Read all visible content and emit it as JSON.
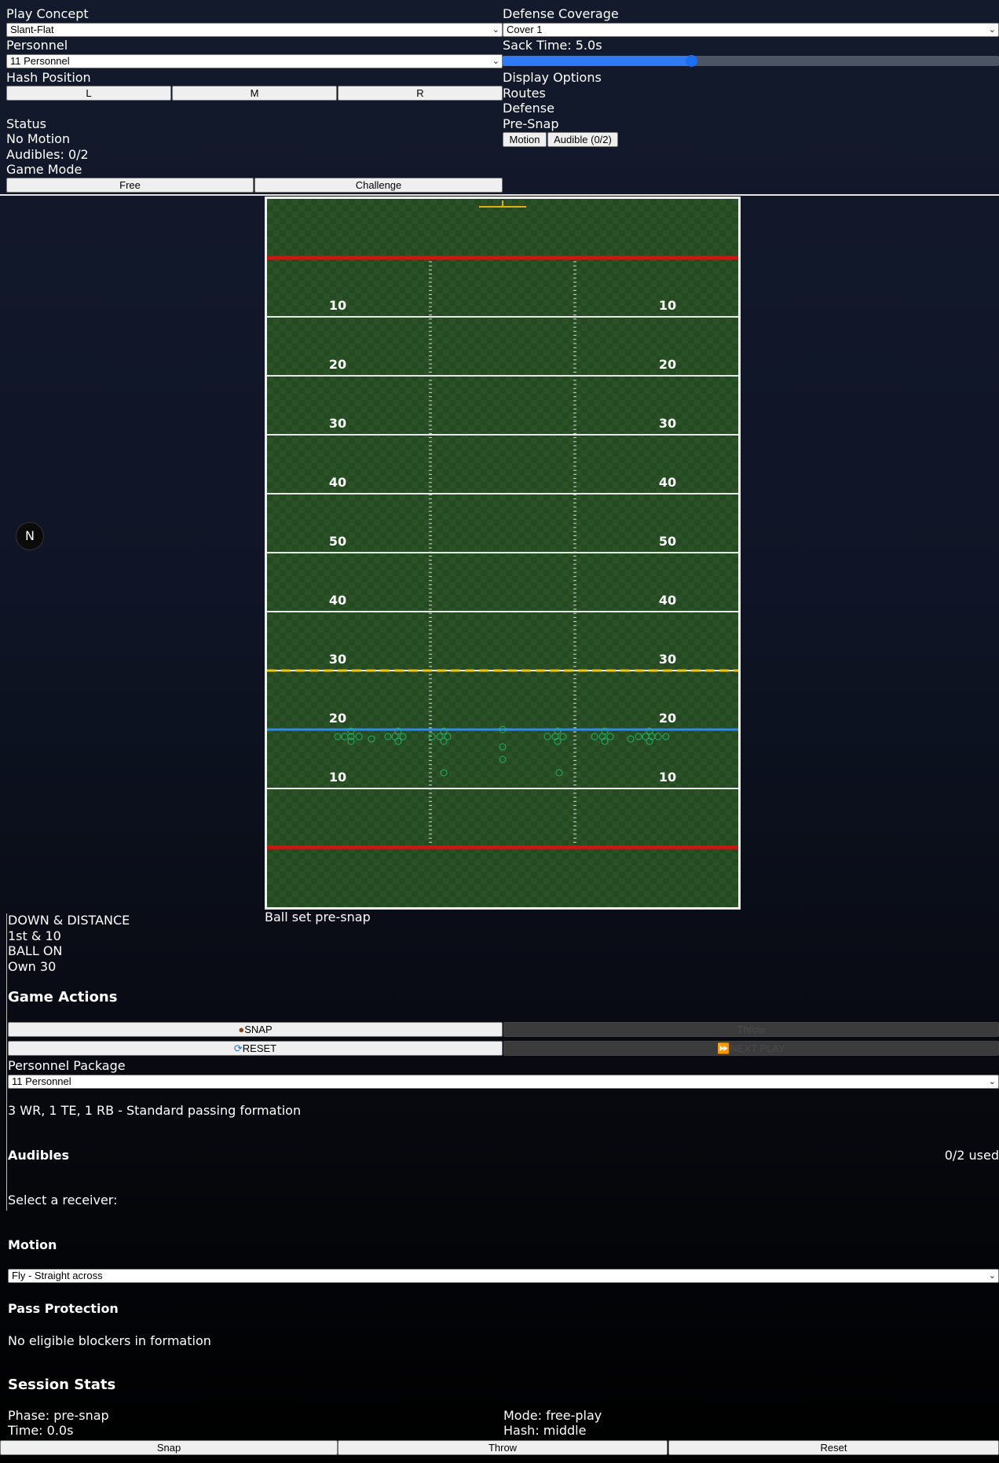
{
  "controls": {
    "play_concept_label": "Play Concept",
    "play_concept_value": "Slant-Flat",
    "defense_coverage_label": "Defense Coverage",
    "defense_coverage_value": "Cover 1",
    "personnel_label": "Personnel",
    "personnel_value": "11 Personnel",
    "sack_time_label": "Sack Time: 5.0s",
    "sack_time_fraction": 0.38,
    "hash_label": "Hash Position",
    "hash_buttons": [
      "L",
      "M",
      "R"
    ],
    "display_options_label": "Display Options",
    "display_options": [
      "Routes",
      "Defense",
      "Pre-Snap"
    ],
    "presnap_buttons": [
      "Motion",
      "Audible (0/2)"
    ],
    "status_label": "Status",
    "status_lines": [
      "No Motion",
      "Audibles: 0/2"
    ],
    "game_mode_label": "Game Mode",
    "game_mode_buttons": [
      "Free",
      "Challenge"
    ]
  },
  "field": {
    "yard_numbers": [
      "10",
      "20",
      "30",
      "40",
      "50",
      "40",
      "30",
      "20",
      "10"
    ],
    "compass_icon": "N",
    "ball_status": "Ball set pre-snap",
    "colors": {
      "turf": "#254a22",
      "endline": "#d0140f",
      "first_down": "#f1c40f",
      "scrimmage": "#2d8cf0",
      "player": "#22b566"
    }
  },
  "down_distance": {
    "title": "DOWN & DISTANCE",
    "value": "1st & 10",
    "ball_on_label": "BALL ON",
    "ball_on_value": "Own 30"
  },
  "actions": {
    "title": "Game Actions",
    "snap": "SNAP",
    "snap_icon": "football-icon",
    "throw": "Throw",
    "reset": "RESET",
    "reset_icon": "reset-icon",
    "next_play": "NEXT PLAY",
    "next_play_icon": "next-icon"
  },
  "personnel_package": {
    "label": "Personnel Package",
    "value": "11 Personnel",
    "description": "3 WR, 1 TE, 1 RB - Standard passing formation"
  },
  "audibles": {
    "title": "Audibles",
    "used": "0/2 used",
    "prompt": "Select a receiver:"
  },
  "motion": {
    "title": "Motion",
    "value": "Fly - Straight across"
  },
  "pass_protection": {
    "title": "Pass Protection",
    "text": "No eligible blockers in formation"
  },
  "session_stats": {
    "title": "Session Stats",
    "phase": "Phase: pre-snap",
    "mode": "Mode: free-play",
    "time": "Time: 0.0s",
    "hash": "Hash: middle"
  },
  "footer_buttons": [
    "Snap",
    "Throw",
    "Reset"
  ]
}
